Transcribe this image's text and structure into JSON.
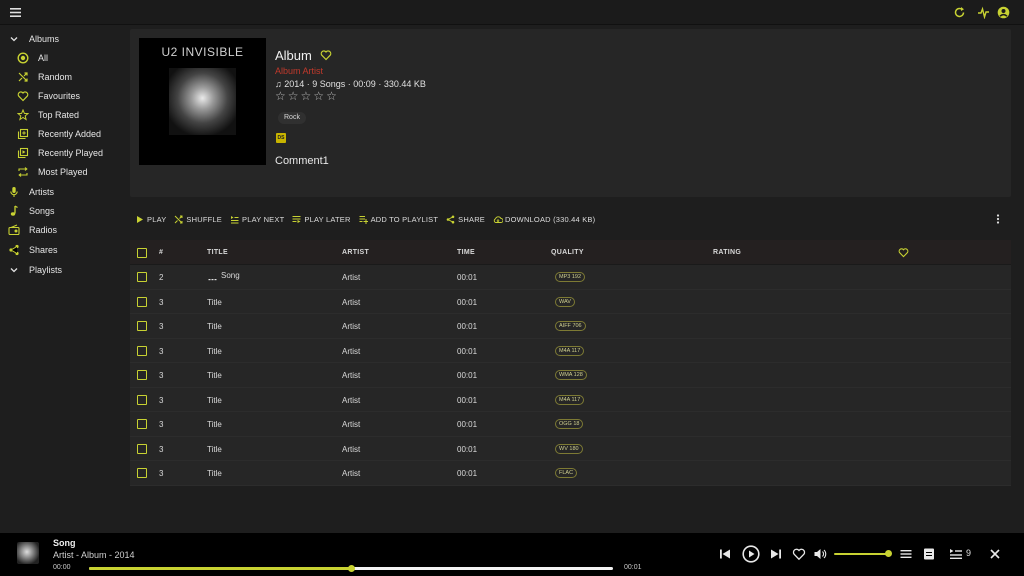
{
  "colors": {
    "accent": "#c8d232",
    "artist_link": "#c0392b",
    "background": "#1e1e1e",
    "panel": "#262626"
  },
  "topbar": {
    "icons": [
      "menu-icon",
      "refresh-icon",
      "activity-icon",
      "account-icon"
    ]
  },
  "sidebar": {
    "albums_label": "Albums",
    "items": [
      {
        "label": "All",
        "icon": "all-icon"
      },
      {
        "label": "Random",
        "icon": "shuffle-icon"
      },
      {
        "label": "Favourites",
        "icon": "heart-icon"
      },
      {
        "label": "Top Rated",
        "icon": "star-icon"
      },
      {
        "label": "Recently Added",
        "icon": "library-add-icon"
      },
      {
        "label": "Recently Played",
        "icon": "library-played-icon"
      },
      {
        "label": "Most Played",
        "icon": "repeat-icon"
      }
    ],
    "artists_label": "Artists",
    "songs_label": "Songs",
    "radios_label": "Radios",
    "shares_label": "Shares",
    "playlists_label": "Playlists"
  },
  "album": {
    "cover_text": "U2 INVISIBLE",
    "title": "Album",
    "artist": "Album Artist",
    "meta": "♫ 2014 · 9 Songs · 00:09 · 330.44 KB",
    "rating": 0,
    "genre": "Rock",
    "badge": "DS",
    "comment": "Comment1"
  },
  "actions": {
    "play": "PLAY",
    "shuffle": "SHUFFLE",
    "play_next": "PLAY NEXT",
    "play_later": "PLAY LATER",
    "add_to_playlist": "ADD TO PLAYLIST",
    "share": "SHARE",
    "download": "DOWNLOAD (330.44 KB)"
  },
  "table": {
    "headers": {
      "num": "#",
      "title": "TITLE",
      "artist": "ARTIST",
      "time": "TIME",
      "quality": "QUALITY",
      "rating": "RATING"
    },
    "rows": [
      {
        "num": "2",
        "title": "Song",
        "artist": "Artist",
        "time": "00:01",
        "quality": "MP3 192",
        "playing": true
      },
      {
        "num": "3",
        "title": "Title",
        "artist": "Artist",
        "time": "00:01",
        "quality": "WAV"
      },
      {
        "num": "3",
        "title": "Title",
        "artist": "Artist",
        "time": "00:01",
        "quality": "AIFF 706"
      },
      {
        "num": "3",
        "title": "Title",
        "artist": "Artist",
        "time": "00:01",
        "quality": "M4A 117"
      },
      {
        "num": "3",
        "title": "Title",
        "artist": "Artist",
        "time": "00:01",
        "quality": "WMA 128"
      },
      {
        "num": "3",
        "title": "Title",
        "artist": "Artist",
        "time": "00:01",
        "quality": "M4A 117"
      },
      {
        "num": "3",
        "title": "Title",
        "artist": "Artist",
        "time": "00:01",
        "quality": "OGG 18"
      },
      {
        "num": "3",
        "title": "Title",
        "artist": "Artist",
        "time": "00:01",
        "quality": "WV 180"
      },
      {
        "num": "3",
        "title": "Title",
        "artist": "Artist",
        "time": "00:01",
        "quality": "FLAC"
      }
    ]
  },
  "player": {
    "song": "Song",
    "subtitle": "Artist - Album - 2014",
    "time_current": "00:00",
    "time_total": "00:01",
    "progress": 0.5,
    "volume": 1.0,
    "queue_count": "9"
  }
}
